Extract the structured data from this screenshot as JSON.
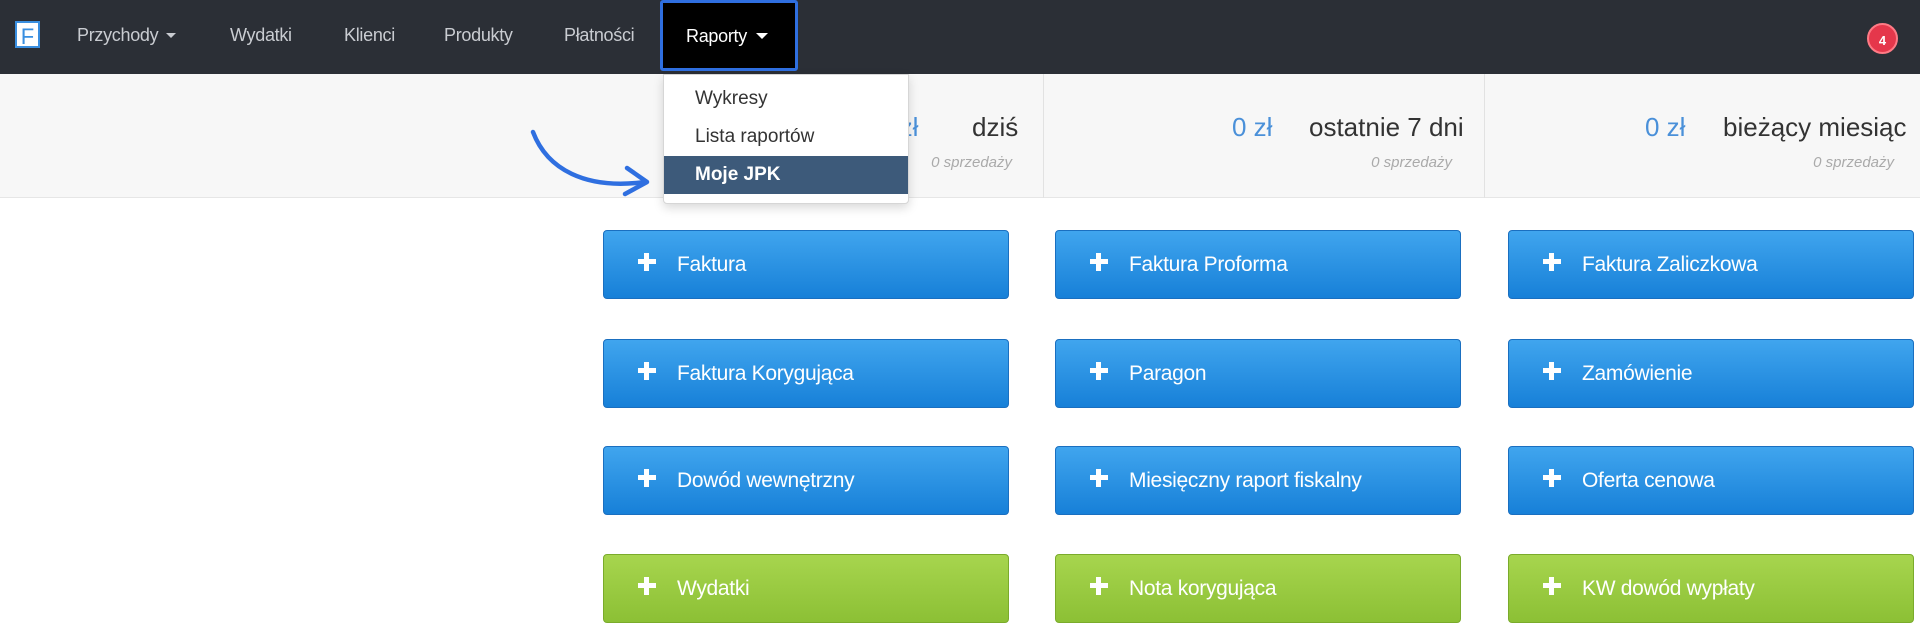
{
  "navbar": {
    "logo_letter": "F",
    "items": [
      {
        "label": "Przychody",
        "has_caret": true
      },
      {
        "label": "Wydatki"
      },
      {
        "label": "Klienci"
      },
      {
        "label": "Produkty"
      },
      {
        "label": "Płatności"
      }
    ],
    "active": {
      "label": "Raporty",
      "has_caret": true
    },
    "notification_count": "4"
  },
  "stats": [
    {
      "amount": "0 zł",
      "label": "dziś",
      "sub": "0 sprzedaży"
    },
    {
      "amount": "0 zł",
      "label": "ostatnie 7 dni",
      "sub": "0 sprzedaży"
    },
    {
      "amount": "0 zł",
      "label": "bieżący miesiąc",
      "sub": "0 sprzedaży"
    }
  ],
  "dropdown": {
    "items": [
      {
        "label": "Wykresy"
      },
      {
        "label": "Lista raportów"
      },
      {
        "label": "Moje JPK",
        "active": true
      }
    ]
  },
  "actions": [
    {
      "label": "Faktura",
      "color": "blue"
    },
    {
      "label": "Faktura Proforma",
      "color": "blue"
    },
    {
      "label": "Faktura Zaliczkowa",
      "color": "blue"
    },
    {
      "label": "Faktura Korygująca",
      "color": "blue"
    },
    {
      "label": "Paragon",
      "color": "blue"
    },
    {
      "label": "Zamówienie",
      "color": "blue"
    },
    {
      "label": "Dowód wewnętrzny",
      "color": "blue"
    },
    {
      "label": "Miesięczny raport fiskalny",
      "color": "blue"
    },
    {
      "label": "Oferta cenowa",
      "color": "blue"
    },
    {
      "label": "Wydatki",
      "color": "green"
    },
    {
      "label": "Nota korygująca",
      "color": "green"
    },
    {
      "label": "KW dowód wypłaty",
      "color": "green"
    }
  ],
  "colors": {
    "navbar_bg": "#2b2f36",
    "active_highlight": "#2f6fe0",
    "blue_button": "#1e88e5",
    "green_button": "#8cc035",
    "dropdown_active": "#3d5a7a",
    "badge": "#e5374b",
    "annotation_arrow": "#2f6fe0"
  },
  "icons": [
    "app-logo-icon",
    "caret-down-icon",
    "plus-icon",
    "annotation-arrow-icon"
  ]
}
